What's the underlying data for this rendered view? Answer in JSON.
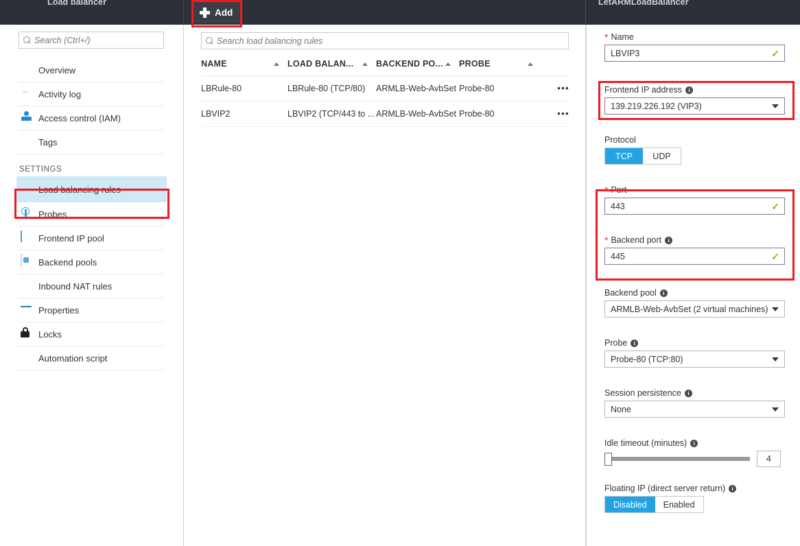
{
  "topbar": {
    "blade1_title": "Load balancer",
    "blade3_title": "LetARMLoadBalancer",
    "add_label": "Add",
    "add_icon": "plus-icon"
  },
  "sidebar": {
    "search_placeholder": "Search (Ctrl+/)",
    "search_icon": "search-icon",
    "items": [
      {
        "label": "Overview",
        "icon": "overview-icon"
      },
      {
        "label": "Activity log",
        "icon": "activity-log-icon"
      },
      {
        "label": "Access control (IAM)",
        "icon": "access-control-icon"
      },
      {
        "label": "Tags",
        "icon": "tag-icon"
      }
    ],
    "settings_header": "SETTINGS",
    "settings_items": [
      {
        "label": "Load balancing rules",
        "icon": "load-balancing-rules-icon",
        "selected": true
      },
      {
        "label": "Probes",
        "icon": "probe-icon",
        "selected": false
      },
      {
        "label": "Frontend IP pool",
        "icon": "frontend-ip-pool-icon",
        "selected": false
      },
      {
        "label": "Backend pools",
        "icon": "backend-pools-icon",
        "selected": false
      },
      {
        "label": "Inbound NAT rules",
        "icon": "inbound-nat-rules-icon",
        "selected": false
      },
      {
        "label": "Properties",
        "icon": "properties-icon",
        "selected": false
      },
      {
        "label": "Locks",
        "icon": "lock-icon",
        "selected": false
      },
      {
        "label": "Automation script",
        "icon": "automation-script-icon",
        "selected": false
      }
    ]
  },
  "rules_list": {
    "search_placeholder": "Search load balancing rules",
    "search_icon": "search-icon",
    "columns": [
      "NAME",
      "LOAD BALAN...",
      "BACKEND PO...",
      "PROBE"
    ],
    "sort_icon": "caret-up-icon",
    "row_menu_label": "•••",
    "rows": [
      {
        "name": "LBRule-80",
        "load_balancing": "LBRule-80 (TCP/80)",
        "backend_pool": "ARMLB-Web-AvbSet",
        "probe": "Probe-80"
      },
      {
        "name": "LBVIP2",
        "load_balancing": "LBVIP2 (TCP/443 to ...",
        "backend_pool": "ARMLB-Web-AvbSet",
        "probe": "Probe-80"
      }
    ]
  },
  "form": {
    "name": {
      "label": "Name",
      "required": true,
      "value": "LBVIP3",
      "valid_icon": "checkmark-icon"
    },
    "frontend_ip": {
      "label": "Frontend IP address",
      "info_icon": "info-icon",
      "value": "139.219.226.192 (VIP3)",
      "chevron_icon": "chevron-down-icon"
    },
    "protocol": {
      "label": "Protocol",
      "options": [
        "TCP",
        "UDP"
      ],
      "selected": "TCP"
    },
    "port": {
      "label": "Port",
      "required": true,
      "value": "443",
      "valid_icon": "checkmark-icon"
    },
    "backend_port": {
      "label": "Backend port",
      "required": true,
      "info_icon": "info-icon",
      "value": "445",
      "valid_icon": "checkmark-icon"
    },
    "backend_pool": {
      "label": "Backend pool",
      "info_icon": "info-icon",
      "value": "ARMLB-Web-AvbSet (2 virtual machines)",
      "chevron_icon": "chevron-down-icon"
    },
    "probe": {
      "label": "Probe",
      "info_icon": "info-icon",
      "value": "Probe-80 (TCP:80)",
      "chevron_icon": "chevron-down-icon"
    },
    "session_persistence": {
      "label": "Session persistence",
      "info_icon": "info-icon",
      "value": "None",
      "chevron_icon": "chevron-down-icon"
    },
    "idle_timeout": {
      "label": "Idle timeout (minutes)",
      "info_icon": "info-icon",
      "value": "4"
    },
    "floating_ip": {
      "label": "Floating IP (direct server return)",
      "info_icon": "info-icon",
      "options": [
        "Disabled",
        "Enabled"
      ],
      "selected": "Disabled"
    }
  },
  "colors": {
    "topbar_bg": "#2d3037",
    "accent_blue": "#24a3e4",
    "selected_nav_bg": "#cfe9f5",
    "annotation_red": "#ee1b24",
    "valid_green": "#7fba00",
    "required_red": "#d93c3c"
  }
}
